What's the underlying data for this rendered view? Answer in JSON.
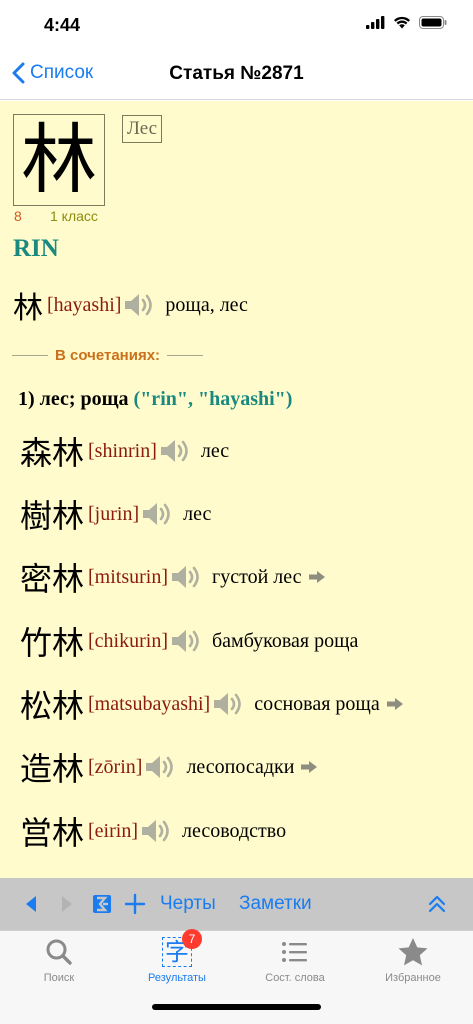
{
  "status": {
    "time": "4:44"
  },
  "nav": {
    "back_label": "Список",
    "title": "Статья №2871"
  },
  "entry": {
    "kanji": "林",
    "meaning": "Лес",
    "strokes": "8",
    "grade": "1 класс",
    "onyomi": "RIN",
    "kun": {
      "word": "林",
      "reading": "[hayashi]",
      "gloss": "роща, лес"
    }
  },
  "combinations": {
    "label": "В сочетаниях:",
    "meaning_title": "1) лес; роща",
    "meaning_readings": "(\"rin\", \"hayashi\")",
    "items": [
      {
        "word": "森林",
        "reading": "[shinrin]",
        "gloss": "лес",
        "has_arrow": false
      },
      {
        "word": "樹林",
        "reading": "[jurin]",
        "gloss": "лес",
        "has_arrow": false
      },
      {
        "word": "密林",
        "reading": "[mitsurin]",
        "gloss": "густой лес",
        "has_arrow": true
      },
      {
        "word": "竹林",
        "reading": "[chikurin]",
        "gloss": "бамбуковая роща",
        "has_arrow": false
      },
      {
        "word": "松林",
        "reading": "[matsubayashi]",
        "gloss": "сосновая роща",
        "has_arrow": true
      },
      {
        "word": "造林",
        "reading": "[zōrin]",
        "gloss": "лесопосадки",
        "has_arrow": true
      },
      {
        "word": "営林",
        "reading": "[eirin]",
        "gloss": "лесоводство",
        "has_arrow": false
      }
    ]
  },
  "toolbar": {
    "strokes_label": "Черты",
    "notes_label": "Заметки"
  },
  "tabs": [
    {
      "label": "Поиск",
      "icon": "search-icon"
    },
    {
      "label": "Результаты",
      "icon": "kanji-icon",
      "glyph": "字",
      "badge": "7"
    },
    {
      "label": "Сост. слова",
      "icon": "list-icon"
    },
    {
      "label": "Избранное",
      "icon": "star-icon"
    }
  ],
  "colors": {
    "accent": "#1a7cf0",
    "content_bg": "#fffbcc",
    "reading": "#8b1a10",
    "onyomi": "#1a8a80",
    "divider_label": "#c9711c"
  }
}
